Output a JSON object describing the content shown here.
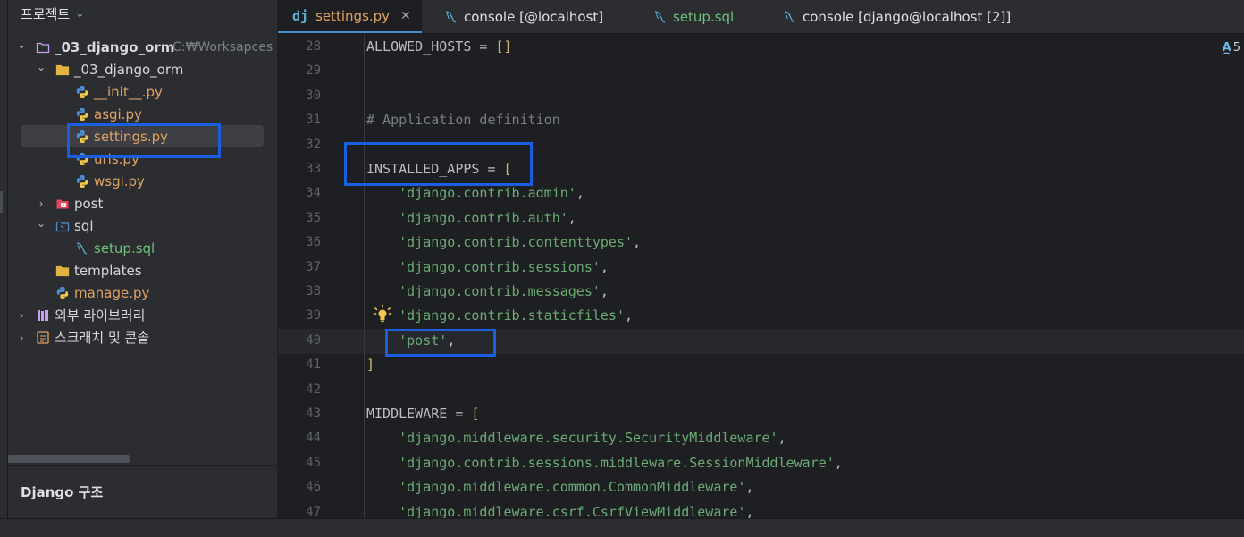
{
  "project_panel": {
    "title": "프로젝트",
    "tree": [
      {
        "label": "_03_django_orm",
        "hint": "C:₩Worksapces",
        "type": "project-folder",
        "expanded": true
      },
      {
        "label": "_03_django_orm",
        "type": "folder",
        "expanded": true
      },
      {
        "label": "__init__.py",
        "type": "python-file"
      },
      {
        "label": "asgi.py",
        "type": "python-file"
      },
      {
        "label": "settings.py",
        "type": "python-file",
        "selected": true
      },
      {
        "label": "urls.py",
        "type": "python-file"
      },
      {
        "label": "wsgi.py",
        "type": "python-file"
      },
      {
        "label": "post",
        "type": "django-app-folder",
        "expanded": false
      },
      {
        "label": "sql",
        "type": "sql-folder",
        "expanded": true
      },
      {
        "label": "setup.sql",
        "type": "sql-file"
      },
      {
        "label": "templates",
        "type": "folder"
      },
      {
        "label": "manage.py",
        "type": "python-file"
      },
      {
        "label": "외부 라이브러리",
        "type": "library",
        "expanded": false
      },
      {
        "label": "스크래치 및 콘솔",
        "type": "scratches",
        "expanded": false
      }
    ],
    "structure_title": "Django 구조"
  },
  "tabs": [
    {
      "label": "settings.py",
      "icon": "django-icon",
      "active": true,
      "closable": true
    },
    {
      "label": "console [@localhost]",
      "icon": "dolphin-icon"
    },
    {
      "label": "setup.sql",
      "icon": "dolphin-icon"
    },
    {
      "label": "console [django@localhost [2]]",
      "icon": "dolphin-icon"
    }
  ],
  "editor": {
    "inspection_count": "5",
    "current_line": "40",
    "lines": [
      {
        "n": "28",
        "tokens": [
          {
            "t": "ALLOWED_HOSTS = ",
            "c": "plain"
          },
          {
            "t": "[]",
            "c": "br"
          }
        ]
      },
      {
        "n": "29",
        "tokens": []
      },
      {
        "n": "30",
        "tokens": []
      },
      {
        "n": "31",
        "tokens": [
          {
            "t": "# Application definition",
            "c": "com"
          }
        ]
      },
      {
        "n": "32",
        "tokens": []
      },
      {
        "n": "33",
        "tokens": [
          {
            "t": "INSTALLED_APPS = ",
            "c": "plain"
          },
          {
            "t": "[",
            "c": "br"
          }
        ]
      },
      {
        "n": "34",
        "tokens": [
          {
            "t": "    ",
            "c": "plain"
          },
          {
            "t": "'django.contrib.admin'",
            "c": "str"
          },
          {
            "t": ",",
            "c": "plain"
          }
        ]
      },
      {
        "n": "35",
        "tokens": [
          {
            "t": "    ",
            "c": "plain"
          },
          {
            "t": "'django.contrib.auth'",
            "c": "str"
          },
          {
            "t": ",",
            "c": "plain"
          }
        ]
      },
      {
        "n": "36",
        "tokens": [
          {
            "t": "    ",
            "c": "plain"
          },
          {
            "t": "'django.contrib.contenttypes'",
            "c": "str"
          },
          {
            "t": ",",
            "c": "plain"
          }
        ]
      },
      {
        "n": "37",
        "tokens": [
          {
            "t": "    ",
            "c": "plain"
          },
          {
            "t": "'django.contrib.sessions'",
            "c": "str"
          },
          {
            "t": ",",
            "c": "plain"
          }
        ]
      },
      {
        "n": "38",
        "tokens": [
          {
            "t": "    ",
            "c": "plain"
          },
          {
            "t": "'django.contrib.messages'",
            "c": "str"
          },
          {
            "t": ",",
            "c": "plain"
          }
        ]
      },
      {
        "n": "39",
        "tokens": [
          {
            "t": "    ",
            "c": "plain"
          },
          {
            "t": "'django.contrib.staticfiles'",
            "c": "str"
          },
          {
            "t": ",",
            "c": "plain"
          }
        ]
      },
      {
        "n": "40",
        "tokens": [
          {
            "t": "    ",
            "c": "plain"
          },
          {
            "t": "'post'",
            "c": "str"
          },
          {
            "t": ",",
            "c": "plain"
          }
        ]
      },
      {
        "n": "41",
        "tokens": [
          {
            "t": "]",
            "c": "br"
          }
        ]
      },
      {
        "n": "42",
        "tokens": []
      },
      {
        "n": "43",
        "tokens": [
          {
            "t": "MIDDLEWARE = ",
            "c": "plain"
          },
          {
            "t": "[",
            "c": "br"
          }
        ]
      },
      {
        "n": "44",
        "tokens": [
          {
            "t": "    ",
            "c": "plain"
          },
          {
            "t": "'django.middleware.security.SecurityMiddleware'",
            "c": "str"
          },
          {
            "t": ",",
            "c": "plain"
          }
        ]
      },
      {
        "n": "45",
        "tokens": [
          {
            "t": "    ",
            "c": "plain"
          },
          {
            "t": "'django.contrib.sessions.middleware.SessionMiddleware'",
            "c": "str"
          },
          {
            "t": ",",
            "c": "plain"
          }
        ]
      },
      {
        "n": "46",
        "tokens": [
          {
            "t": "    ",
            "c": "plain"
          },
          {
            "t": "'django.middleware.common.CommonMiddleware'",
            "c": "str"
          },
          {
            "t": ",",
            "c": "plain"
          }
        ]
      },
      {
        "n": "47",
        "tokens": [
          {
            "t": "    ",
            "c": "plain"
          },
          {
            "t": "'django.middleware.csrf.CsrfViewMiddleware'",
            "c": "str"
          },
          {
            "t": ",",
            "c": "plain"
          }
        ]
      }
    ]
  },
  "colors": {
    "accent": "#4c8ddb",
    "highlight_box": "#1a5fe0",
    "string": "#6aab73",
    "comment": "#7a7e85",
    "bracket": "#d5b778",
    "python_file": "#e0a264",
    "sql_file": "#6ec07a"
  }
}
